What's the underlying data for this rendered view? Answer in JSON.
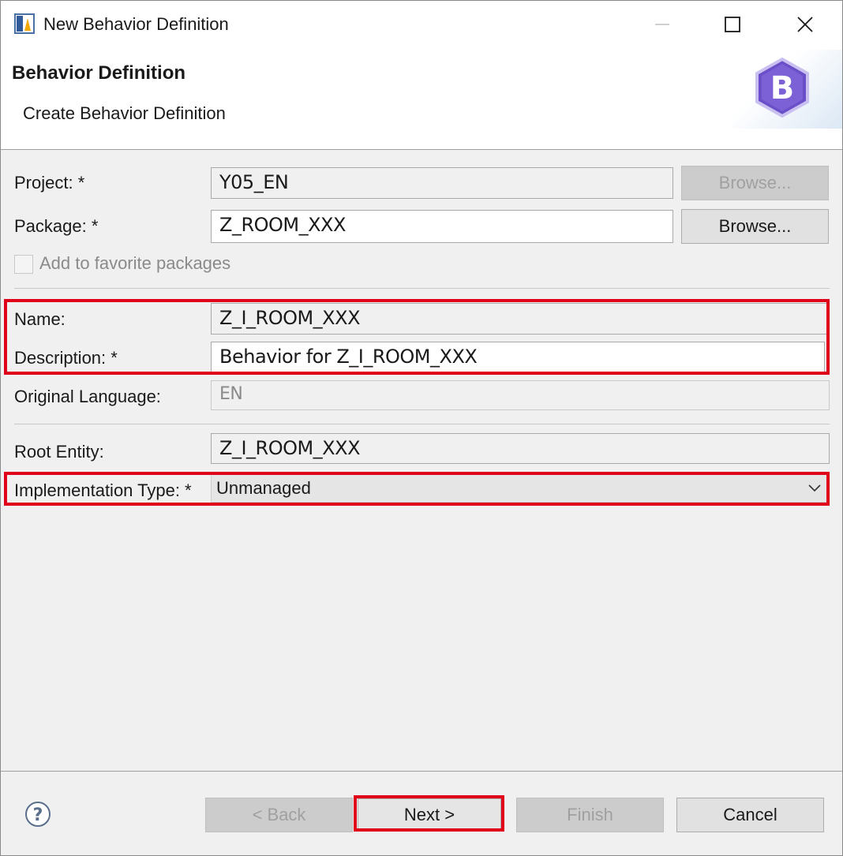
{
  "window": {
    "title": "New Behavior Definition",
    "icons": {
      "app": "eclipse-adt-icon",
      "minimize": "minimize-icon",
      "maximize": "maximize-icon",
      "close": "close-icon"
    }
  },
  "header": {
    "title": "Behavior Definition",
    "subtitle": "Create Behavior Definition",
    "logo_letter": "B",
    "logo_color": "#6a4fc8"
  },
  "form": {
    "project": {
      "label": "Project: *",
      "value": "Y05_EN",
      "browse": "Browse..."
    },
    "package": {
      "label": "Package: *",
      "value": "Z_ROOM_XXX",
      "browse": "Browse..."
    },
    "favorite": {
      "label": "Add to favorite packages",
      "checked": false
    },
    "name": {
      "label": "Name:",
      "value": "Z_I_ROOM_XXX"
    },
    "description": {
      "label": "Description: *",
      "value": "Behavior for Z_I_ROOM_XXX"
    },
    "language": {
      "label": "Original Language:",
      "value": "EN"
    },
    "root_entity": {
      "label": "Root Entity:",
      "value": "Z_I_ROOM_XXX"
    },
    "implementation_type": {
      "label": "Implementation Type: *",
      "value": "Unmanaged"
    }
  },
  "footer": {
    "back": "< Back",
    "next": "Next >",
    "finish": "Finish",
    "cancel": "Cancel",
    "help_icon": "help-icon"
  },
  "highlight_color": "#e0001a"
}
